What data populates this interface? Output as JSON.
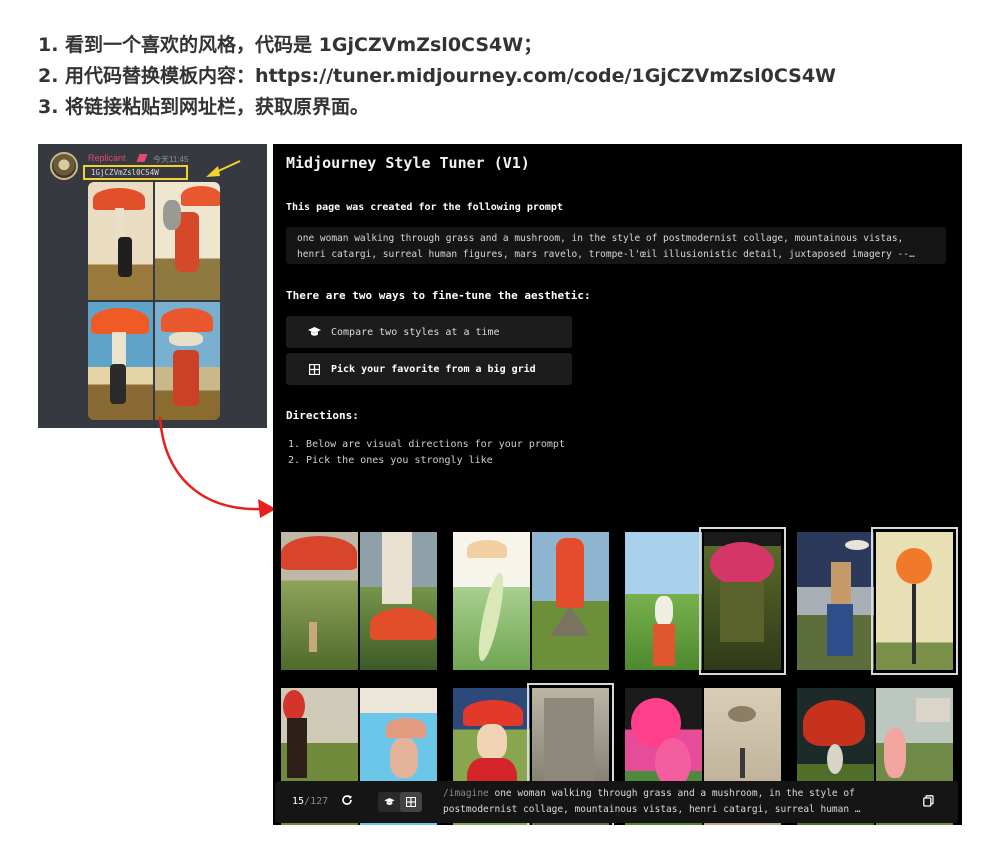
{
  "instructions": [
    "1. 看到一个喜欢的风格，代码是 1GjCZVmZsl0CS4W；",
    "2. 用代码替换模板内容：https://tuner.midjourney.com/code/1GjCZVmZsl0CS4W",
    "3. 将链接粘贴到网址栏，获取原界面。"
  ],
  "discord": {
    "username": "Replicant",
    "time": "今天11:45",
    "code": "1GjCZVmZsl0CS4W",
    "avatar_icon": "avatar",
    "highlight_color": "#f5d22b"
  },
  "tuner": {
    "title": "Midjourney Style Tuner (V1)",
    "prompt_heading": "This page was created for the following prompt",
    "prompt_line1": "one woman walking through grass and a mushroom, in the style of postmodernist collage, mountainous vistas,",
    "prompt_line2": "henri catargi, surreal human figures, mars ravelo, trompe-l'œil illusionistic detail, juxtaposed imagery --…",
    "ways_heading": "There are two ways to fine-tune the aesthetic:",
    "option_compare": "Compare two styles at a time",
    "option_grid": "Pick your favorite from a big grid",
    "directions_heading": "Directions:",
    "direction_1": "1. Below are visual directions for your prompt",
    "direction_2": "2. Pick the ones you strongly like",
    "bottom": {
      "current": "15",
      "total": "/127",
      "imagine_keyword": "/imagine",
      "imagine_line1": " one woman walking through grass and a mushroom, in the style of",
      "imagine_line2": "postmodernist collage, mountainous vistas, henri catargi, surreal human …"
    }
  },
  "colors": {
    "arrow_red": "#e8201c",
    "arrow_yellow": "#f5d22b",
    "username": "#e24b71"
  }
}
